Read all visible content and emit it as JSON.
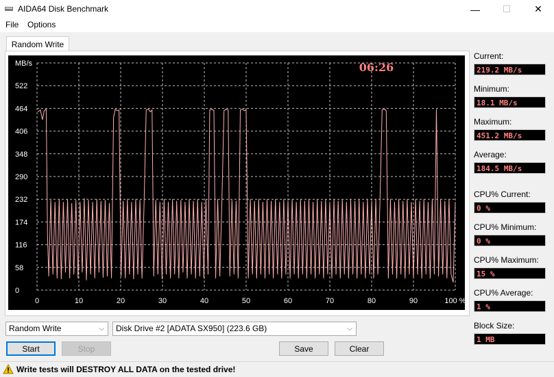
{
  "window": {
    "title": "AIDA64 Disk Benchmark",
    "minimize": "—",
    "maximize": "☐",
    "close": "✕"
  },
  "menu": {
    "file": "File",
    "options": "Options"
  },
  "tab": {
    "label": "Random Write"
  },
  "chart_data": {
    "type": "line",
    "ylabel": "MB/s",
    "y_ticks": [
      "0",
      "58",
      "116",
      "174",
      "232",
      "290",
      "348",
      "406",
      "464",
      "522"
    ],
    "x_ticks": [
      "0",
      "10",
      "20",
      "30",
      "40",
      "50",
      "60",
      "70",
      "80",
      "90",
      "100 %"
    ],
    "ylim": [
      0,
      580
    ],
    "xlim": [
      0,
      100
    ],
    "timer": "06:26",
    "grid": true,
    "line_color": "#ffb0b0",
    "series": [
      {
        "points": [
          [
            0.2,
            455
          ],
          [
            0.8,
            460
          ],
          [
            1.3,
            435
          ],
          [
            1.7,
            458
          ],
          [
            2.2,
            462
          ],
          [
            2.5,
            140
          ],
          [
            2.8,
            35
          ],
          [
            3.3,
            230
          ],
          [
            3.8,
            40
          ],
          [
            4.3,
            225
          ],
          [
            4.8,
            30
          ],
          [
            5.3,
            232
          ],
          [
            5.8,
            28
          ],
          [
            6.3,
            225
          ],
          [
            6.8,
            45
          ],
          [
            7.3,
            232
          ],
          [
            7.8,
            30
          ],
          [
            8.3,
            222
          ],
          [
            8.8,
            40
          ],
          [
            9.3,
            230
          ],
          [
            9.8,
            30
          ],
          [
            10.3,
            225
          ],
          [
            10.8,
            45
          ],
          [
            11.3,
            235
          ],
          [
            11.8,
            25
          ],
          [
            12.3,
            230
          ],
          [
            12.8,
            40
          ],
          [
            13.3,
            225
          ],
          [
            13.8,
            30
          ],
          [
            14.3,
            232
          ],
          [
            14.8,
            45
          ],
          [
            15.3,
            228
          ],
          [
            15.8,
            32
          ],
          [
            16.3,
            230
          ],
          [
            16.8,
            35
          ],
          [
            17.3,
            222
          ],
          [
            17.8,
            30
          ],
          [
            18.3,
            440
          ],
          [
            18.7,
            462
          ],
          [
            19.2,
            458
          ],
          [
            19.6,
            460
          ],
          [
            20.1,
            35
          ],
          [
            20.6,
            228
          ],
          [
            21.1,
            30
          ],
          [
            21.6,
            232
          ],
          [
            22.1,
            40
          ],
          [
            22.6,
            225
          ],
          [
            23.1,
            28
          ],
          [
            23.6,
            232
          ],
          [
            24.1,
            40
          ],
          [
            24.6,
            230
          ],
          [
            25.1,
            30
          ],
          [
            25.6,
            225
          ],
          [
            26.1,
            460
          ],
          [
            26.6,
            462
          ],
          [
            27.1,
            455
          ],
          [
            27.5,
            460
          ],
          [
            27.9,
            35
          ],
          [
            28.4,
            230
          ],
          [
            28.9,
            40
          ],
          [
            29.4,
            225
          ],
          [
            29.9,
            28
          ],
          [
            30.4,
            232
          ],
          [
            30.9,
            40
          ],
          [
            31.4,
            225
          ],
          [
            31.9,
            30
          ],
          [
            32.4,
            232
          ],
          [
            32.9,
            40
          ],
          [
            33.4,
            228
          ],
          [
            33.9,
            30
          ],
          [
            34.4,
            230
          ],
          [
            34.9,
            45
          ],
          [
            35.4,
            225
          ],
          [
            35.9,
            30
          ],
          [
            36.4,
            232
          ],
          [
            36.9,
            40
          ],
          [
            37.4,
            228
          ],
          [
            37.9,
            30
          ],
          [
            38.4,
            232
          ],
          [
            38.9,
            35
          ],
          [
            39.4,
            225
          ],
          [
            39.9,
            30
          ],
          [
            40.4,
            232
          ],
          [
            40.9,
            40
          ],
          [
            41.3,
            460
          ],
          [
            41.8,
            462
          ],
          [
            42.3,
            458
          ],
          [
            42.7,
            30
          ],
          [
            43.2,
            232
          ],
          [
            43.7,
            35
          ],
          [
            44.2,
            225
          ],
          [
            44.7,
            458
          ],
          [
            45.2,
            462
          ],
          [
            45.7,
            460
          ],
          [
            46.1,
            35
          ],
          [
            46.6,
            230
          ],
          [
            47.1,
            40
          ],
          [
            47.6,
            228
          ],
          [
            48.1,
            30
          ],
          [
            48.6,
            460
          ],
          [
            49.1,
            462
          ],
          [
            49.6,
            458
          ],
          [
            50.0,
            460
          ],
          [
            50.5,
            30
          ],
          [
            51.0,
            232
          ],
          [
            51.5,
            40
          ],
          [
            52.0,
            228
          ],
          [
            52.5,
            30
          ],
          [
            53.0,
            232
          ],
          [
            53.5,
            40
          ],
          [
            54.0,
            225
          ],
          [
            54.5,
            30
          ],
          [
            55.0,
            232
          ],
          [
            55.5,
            40
          ],
          [
            56.0,
            228
          ],
          [
            56.5,
            30
          ],
          [
            57.0,
            232
          ],
          [
            57.5,
            40
          ],
          [
            58.0,
            225
          ],
          [
            58.5,
            30
          ],
          [
            59.0,
            232
          ],
          [
            59.5,
            40
          ],
          [
            60.0,
            228
          ],
          [
            60.5,
            30
          ],
          [
            61.0,
            232
          ],
          [
            61.5,
            40
          ],
          [
            62.0,
            225
          ],
          [
            62.5,
            30
          ],
          [
            63.0,
            232
          ],
          [
            63.5,
            40
          ],
          [
            64.0,
            228
          ],
          [
            64.5,
            30
          ],
          [
            65.0,
            232
          ],
          [
            65.5,
            40
          ],
          [
            66.0,
            225
          ],
          [
            66.5,
            30
          ],
          [
            67.0,
            232
          ],
          [
            67.5,
            40
          ],
          [
            68.0,
            228
          ],
          [
            68.5,
            30
          ],
          [
            69.0,
            232
          ],
          [
            69.5,
            40
          ],
          [
            70.0,
            225
          ],
          [
            70.5,
            30
          ],
          [
            71.0,
            232
          ],
          [
            71.5,
            40
          ],
          [
            72.0,
            228
          ],
          [
            72.5,
            30
          ],
          [
            73.0,
            232
          ],
          [
            73.5,
            40
          ],
          [
            74.0,
            225
          ],
          [
            74.5,
            30
          ],
          [
            75.0,
            232
          ],
          [
            75.5,
            40
          ],
          [
            76.0,
            228
          ],
          [
            76.5,
            30
          ],
          [
            77.0,
            232
          ],
          [
            77.5,
            40
          ],
          [
            78.0,
            225
          ],
          [
            78.5,
            30
          ],
          [
            79.0,
            232
          ],
          [
            79.5,
            40
          ],
          [
            80.0,
            228
          ],
          [
            80.5,
            30
          ],
          [
            81.0,
            232
          ],
          [
            81.5,
            40
          ],
          [
            82.0,
            228
          ],
          [
            82.5,
            460
          ],
          [
            83.0,
            462
          ],
          [
            83.5,
            458
          ],
          [
            84.0,
            30
          ],
          [
            84.5,
            232
          ],
          [
            85.0,
            40
          ],
          [
            85.5,
            225
          ],
          [
            86.0,
            30
          ],
          [
            86.5,
            232
          ],
          [
            87.0,
            40
          ],
          [
            87.5,
            228
          ],
          [
            88.0,
            30
          ],
          [
            88.5,
            232
          ],
          [
            89.0,
            40
          ],
          [
            89.5,
            225
          ],
          [
            90.0,
            30
          ],
          [
            90.5,
            232
          ],
          [
            91.0,
            40
          ],
          [
            91.5,
            228
          ],
          [
            92.0,
            30
          ],
          [
            92.5,
            232
          ],
          [
            93.0,
            40
          ],
          [
            93.5,
            225
          ],
          [
            94.0,
            30
          ],
          [
            94.5,
            232
          ],
          [
            95.0,
            40
          ],
          [
            95.5,
            462
          ],
          [
            96.0,
            35
          ],
          [
            96.5,
            232
          ],
          [
            97.0,
            40
          ],
          [
            97.5,
            228
          ],
          [
            98.0,
            30
          ],
          [
            98.5,
            232
          ],
          [
            99.0,
            40
          ],
          [
            99.5,
            20
          ],
          [
            100,
            225
          ]
        ]
      }
    ]
  },
  "stats": {
    "current_label": "Current:",
    "current_value": "219.2 MB/s",
    "minimum_label": "Minimum:",
    "minimum_value": "18.1 MB/s",
    "maximum_label": "Maximum:",
    "maximum_value": "451.2 MB/s",
    "average_label": "Average:",
    "average_value": "184.5 MB/s",
    "cpu_current_label": "CPU% Current:",
    "cpu_current_value": "0 %",
    "cpu_minimum_label": "CPU% Minimum:",
    "cpu_minimum_value": "0 %",
    "cpu_maximum_label": "CPU% Maximum:",
    "cpu_maximum_value": "15 %",
    "cpu_average_label": "CPU% Average:",
    "cpu_average_value": "1 %",
    "block_size_label": "Block Size:",
    "block_size_value": "1 MB"
  },
  "controls": {
    "test_select": "Random Write",
    "drive_select": "Disk Drive #2  [ADATA SX950]  (223.6 GB)",
    "start": "Start",
    "stop": "Stop",
    "save": "Save",
    "clear": "Clear"
  },
  "status": {
    "warning": "Write tests will DESTROY ALL DATA on the tested drive!"
  },
  "colors": {
    "chart_bg": "#000000",
    "grid": "#c0c0c0",
    "line": "#ffb0b0",
    "timer": "#ff8080",
    "value_text": "#ff8080"
  }
}
